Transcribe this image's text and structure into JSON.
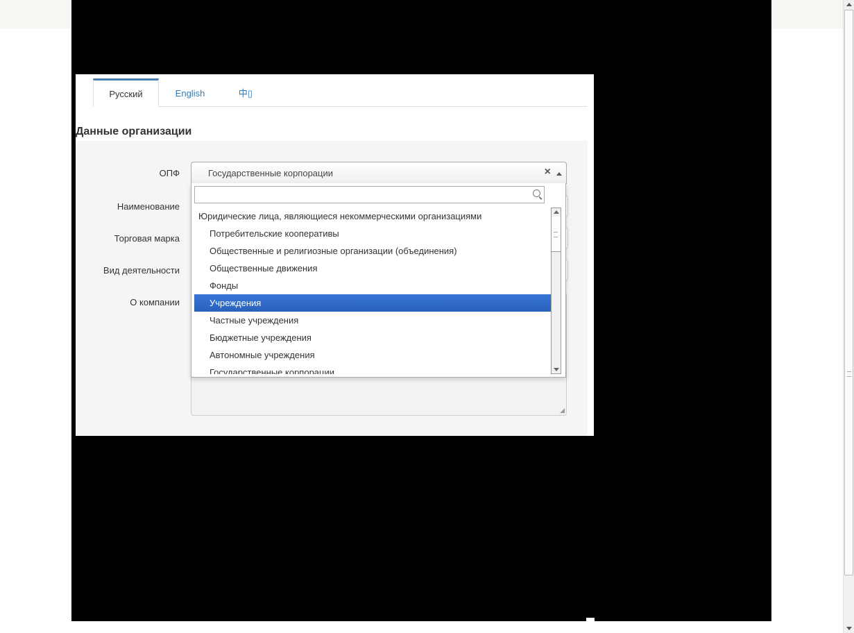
{
  "tabs": [
    {
      "label": "Русский",
      "active": true
    },
    {
      "label": "English",
      "active": false
    },
    {
      "label": "中▯",
      "active": false
    }
  ],
  "section_title": "Данные организации",
  "labels": {
    "opf": "ОПФ",
    "name": "Наименование",
    "brand": "Торговая марка",
    "activity": "Вид деятельности",
    "about": "О компании"
  },
  "select": {
    "value": "Государственные корпорации",
    "clear_glyph": "×",
    "search_value": ""
  },
  "options": [
    {
      "label": "Юридические лица, являющиеся некоммерческими организациями",
      "group": true
    },
    {
      "label": "Потребительские кооперативы"
    },
    {
      "label": "Общественные и религиозные организации (объединения)"
    },
    {
      "label": "Общественные движения"
    },
    {
      "label": "Фонды"
    },
    {
      "label": "Учреждения",
      "highlighted": true
    },
    {
      "label": "Частные учреждения"
    },
    {
      "label": "Бюджетные учреждения"
    },
    {
      "label": "Автономные учреждения"
    },
    {
      "label": "Государственные корпорации"
    }
  ],
  "colors": {
    "highlight": "#3875d7",
    "link": "#337ab7",
    "redaction": "#000000"
  }
}
